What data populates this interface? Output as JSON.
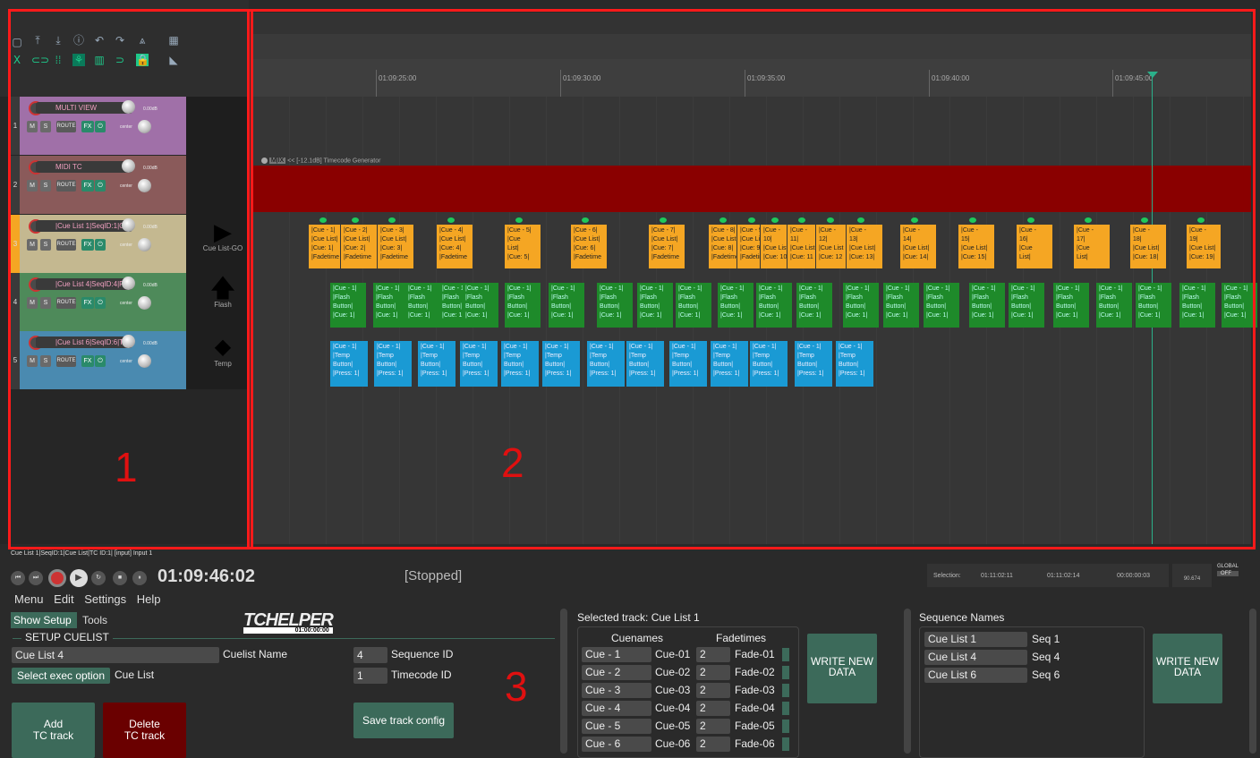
{
  "tracks": [
    {
      "num": "1",
      "name": "MULTI VIEW",
      "color": "#a070a8",
      "vol": "0.00dB"
    },
    {
      "num": "2",
      "name": "MIDI TC",
      "color": "#8a5a5a",
      "vol": "0.00dB"
    },
    {
      "num": "3",
      "name": "|Cue List 1|SeqID:1|Cu",
      "color": "#c4b890",
      "vol": "0.00dB"
    },
    {
      "num": "4",
      "name": "|Cue List 4|SeqID:4|Fl",
      "color": "#4e8a5a",
      "vol": "0.00dB"
    },
    {
      "num": "5",
      "name": "|Cue List 6|SeqID:6|Te",
      "color": "#4a8ab0",
      "vol": "0.00dB"
    }
  ],
  "track_controls": {
    "m": "M",
    "s": "S",
    "route": "ROUTE",
    "fx": "FX",
    "pan": "center"
  },
  "track_panels": [
    {
      "label": "Cue List-GO",
      "icon": "play-triangle-icon"
    },
    {
      "label": "Flash",
      "icon": "up-arrow-icon"
    },
    {
      "label": "Temp",
      "icon": "diamond-icon"
    }
  ],
  "timeline": {
    "ticks": [
      "01:09:25:00",
      "01:09:30:00",
      "01:09:35:00",
      "01:09:40:00",
      "01:09:45:00"
    ],
    "tc_item": "<< [-12.1dB] Timecode Generator",
    "tc_item_badge": "M|IX"
  },
  "cues_yellow": [
    "|Cue - 1|\n|Cue List|\n|Cue: 1|\n|Fadetime",
    "|Cue - 2|\n|Cue List|\n|Cue: 2|\n|Fadetime",
    "|Cue - 3|\n|Cue List|\n|Cue: 3|\n|Fadetime",
    "|Cue - 4|\n|Cue List|\n|Cue: 4|\n|Fadetime",
    "|Cue - 5|\n|Cue\nList|\n|Cue: 5|",
    "|Cue - 6|\n|Cue List|\n|Cue: 6|\n|Fadetime",
    "|Cue - 7|\n|Cue List|\n|Cue: 7|\n|Fadetime",
    "|Cue - 8|\n|Cue List|\n|Cue: 8|\n|Fadetime",
    "|Cue - 9|\n|Cue List\n|Cue: 9|\n|Fadetime",
    "|Cue -\n10|\n|Cue List\n|Cue: 10",
    "|Cue -\n11|\n|Cue List\n|Cue: 11",
    "|Cue -\n12|\n|Cue List\n|Cue: 12",
    "|Cue -\n13|\n|Cue List|\n|Cue: 13|",
    "|Cue -\n14|\n|Cue List|\n|Cue: 14|",
    "|Cue -\n15|\n|Cue List|\n|Cue: 15|",
    "|Cue -\n16|\n|Cue\nList|",
    "|Cue -\n17|\n|Cue\nList|",
    "|Cue -\n18|\n|Cue List|\n|Cue: 18|",
    "|Cue -\n19|\n|Cue List|\n|Cue: 19|"
  ],
  "cues_green_text": "|Cue - 1|\n|Flash\nButton|\n|Cue: 1|",
  "cues_blue_text": "|Cue - 1|\n|Temp\nButton|\n|Press: 1|",
  "transport": {
    "path": "Cue List 1|SeqID:1|Cue List|TC ID:1| [input] Input 1",
    "time": "01:09:46:02",
    "status": "[Stopped]",
    "selection_label": "Selection:",
    "sel_start": "01:11:02:11",
    "sel_end": "01:11:02:14",
    "sel_len": "00:00:00:03",
    "bpm": "90.674",
    "global": "GLOBAL",
    "global_state": "OFF"
  },
  "menu": [
    "Menu",
    "Edit",
    "Settings",
    "Help"
  ],
  "helper": {
    "tabs": [
      "Show Setup",
      "Tools"
    ],
    "logo": "TCHELPER",
    "logo_sub": "01:00:00:00",
    "section": "SETUP CUELIST",
    "cuelist_name_value": "Cue List 4",
    "cuelist_name_label": "Cuelist Name",
    "seq_id_value": "4",
    "seq_id_label": "Sequence ID",
    "tc_id_value": "1",
    "tc_id_label": "Timecode ID",
    "exec_option_button": "Select exec option",
    "exec_option_value": "Cue List",
    "save_button": "Save track config",
    "add_button": "Add\nTC track",
    "delete_button": "Delete\nTC track"
  },
  "selected_track": {
    "title": "Selected track: Cue List 1",
    "col1": "Cuenames",
    "col2": "Fadetimes",
    "rows": [
      {
        "cue": "Cue - 1",
        "name": "Cue-01",
        "fade": "2",
        "fname": "Fade-01"
      },
      {
        "cue": "Cue - 2",
        "name": "Cue-02",
        "fade": "2",
        "fname": "Fade-02"
      },
      {
        "cue": "Cue - 3",
        "name": "Cue-03",
        "fade": "2",
        "fname": "Fade-03"
      },
      {
        "cue": "Cue - 4",
        "name": "Cue-04",
        "fade": "2",
        "fname": "Fade-04"
      },
      {
        "cue": "Cue - 5",
        "name": "Cue-05",
        "fade": "2",
        "fname": "Fade-05"
      },
      {
        "cue": "Cue - 6",
        "name": "Cue-06",
        "fade": "2",
        "fname": "Fade-06"
      }
    ],
    "write_button": "WRITE NEW\nDATA"
  },
  "sequence_names": {
    "title": "Sequence Names",
    "rows": [
      {
        "list": "Cue List 1",
        "seq": "Seq 1"
      },
      {
        "list": "Cue List 4",
        "seq": "Seq 4"
      },
      {
        "list": "Cue List 6",
        "seq": "Seq 6"
      }
    ],
    "write_button": "WRITE NEW\nDATA"
  },
  "annotations": [
    "1",
    "2",
    "3"
  ]
}
